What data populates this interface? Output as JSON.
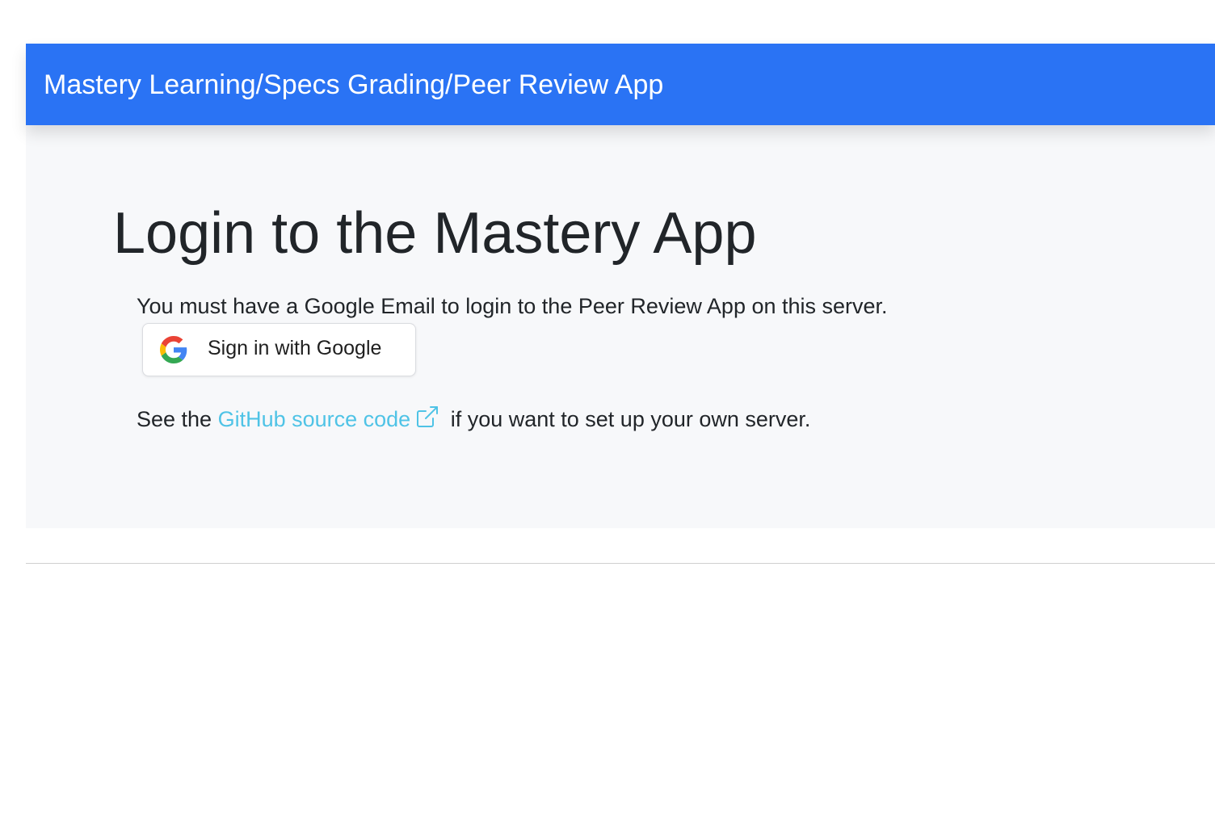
{
  "navbar": {
    "brand": "Mastery Learning/Specs Grading/Peer Review App",
    "background_color": "#2a73f4"
  },
  "main": {
    "title": "Login to the Mastery App",
    "notice": "You must have a Google Email to login to the Peer Review App on this server.",
    "google_button": {
      "icon": "google-g-icon",
      "label": "Sign in with Google"
    },
    "source_line": {
      "prefix": "See the ",
      "link_text": "GitHub source code",
      "link_icon": "external-link-icon",
      "suffix": " if you want to set up your own server.",
      "link_color": "#4fc3e6"
    },
    "background_color": "#f7f8fa"
  }
}
